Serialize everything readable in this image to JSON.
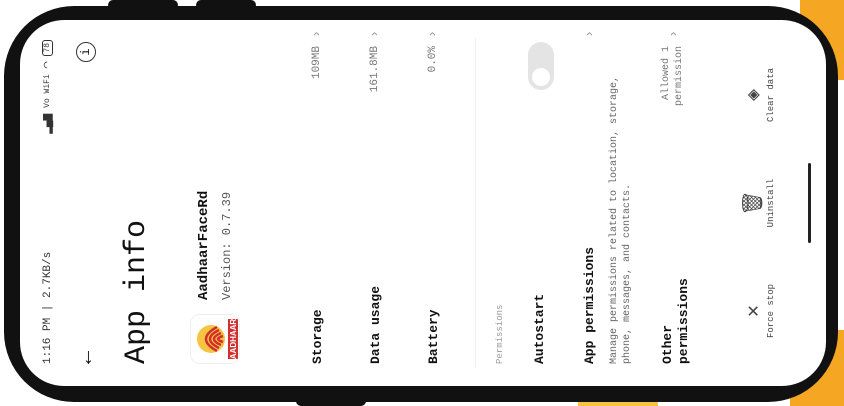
{
  "status": {
    "time_speed": "1:16 PM | 2.7KB/s",
    "signal": "Vo WiFi",
    "battery": "78"
  },
  "header": {
    "title": "App info"
  },
  "app": {
    "name": "AadhaarFaceRd",
    "version": "Version: 0.7.39",
    "icon_label": "AADHAAR"
  },
  "rows": [
    {
      "label": "Storage",
      "value": "109MB"
    },
    {
      "label": "Data usage",
      "value": "161.8MB"
    },
    {
      "label": "Battery",
      "value": "0.0%"
    }
  ],
  "permissions": {
    "section_label": "Permissions",
    "autostart": "Autostart",
    "app_permissions": "App permissions",
    "app_permissions_desc": "Manage permissions related to location, storage, phone, messages, and contacts.",
    "other_permissions": "Other permissions",
    "other_permissions_value": "Allowed 1 permission"
  },
  "actions": {
    "force_stop": "Force stop",
    "uninstall": "Uninstall",
    "clear_data": "Clear data"
  },
  "colors": {
    "accent": "#f5a623",
    "aadhaar_red": "#d32f2f",
    "aadhaar_yellow": "#f5c542"
  }
}
